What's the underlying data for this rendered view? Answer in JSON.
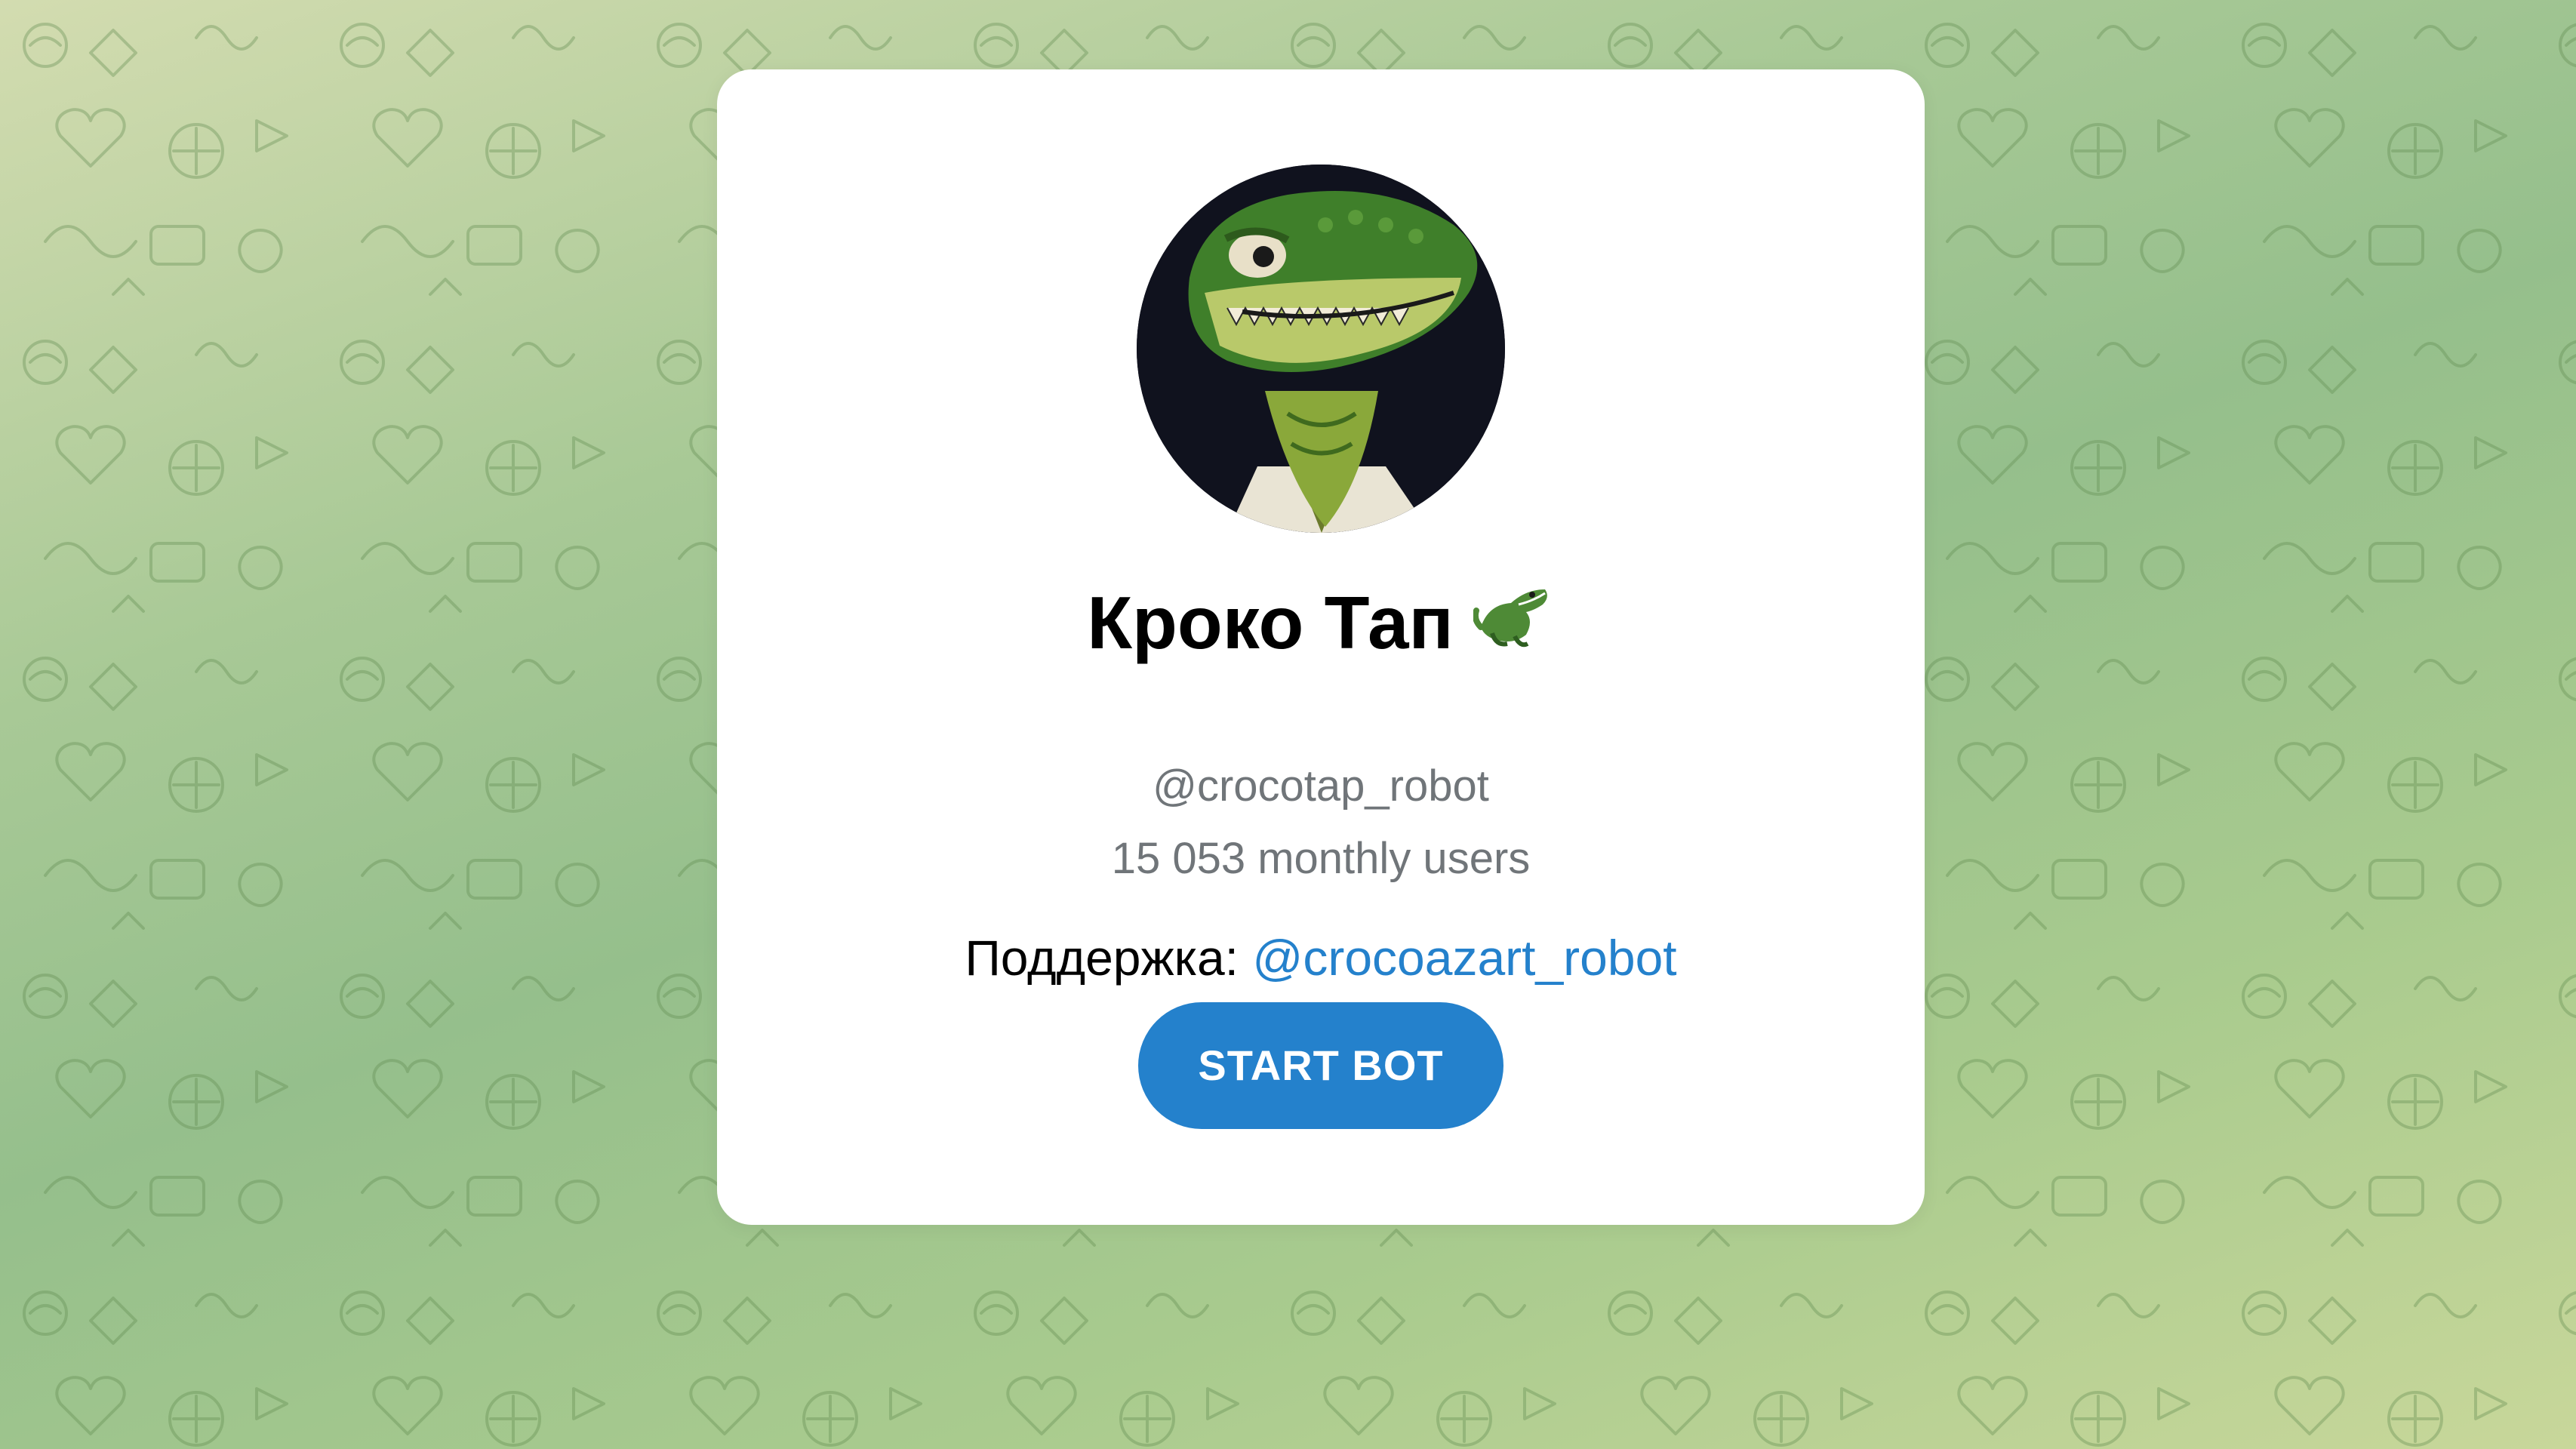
{
  "bot": {
    "name": "Кроко Тап",
    "name_emoji": "crocodile-emoji",
    "username": "@crocotap_robot",
    "monthly_users": "15 053 monthly users",
    "support_label": "Поддержка:",
    "support_link": "@crocoazart_robot",
    "start_button_label": "START BOT",
    "avatar": "crocodile-avatar"
  },
  "colors": {
    "accent": "#2481cc",
    "secondary_text": "#707579",
    "card_background": "#ffffff",
    "page_background_green": "#a8c996"
  }
}
